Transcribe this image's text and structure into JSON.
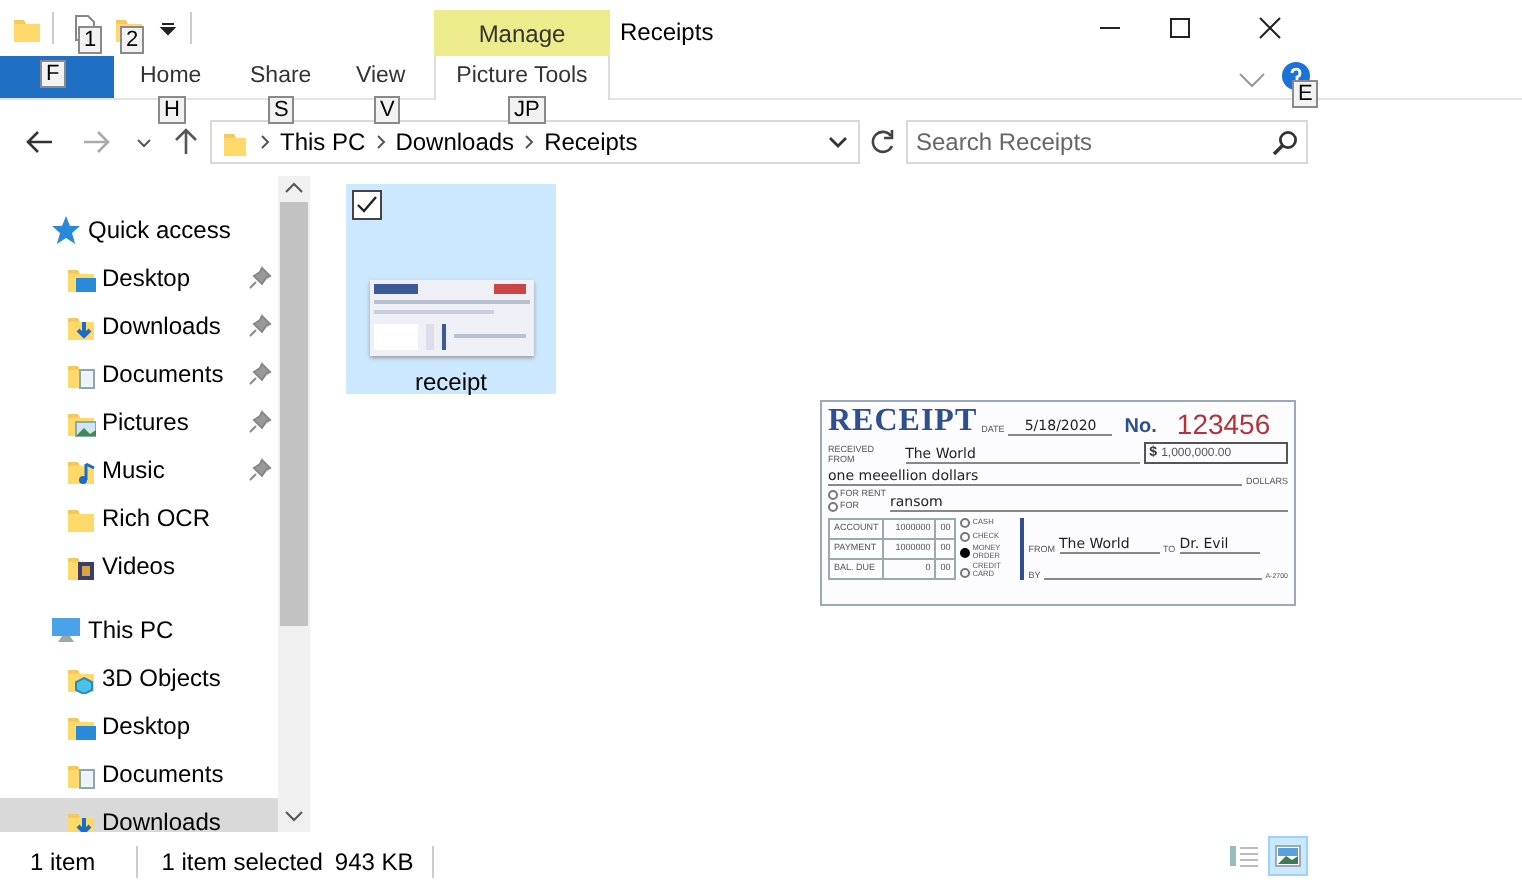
{
  "quick_access_toolbar": {
    "keytips": [
      "1",
      "2"
    ]
  },
  "window": {
    "title": "Receipts"
  },
  "context_tab": {
    "label": "Manage",
    "group": "Picture Tools",
    "keytip": "JP"
  },
  "ribbon_tabs": [
    {
      "kind": "file",
      "keytip": "F"
    },
    {
      "kind": "tab",
      "label": "Home",
      "keytip": "H"
    },
    {
      "kind": "tab",
      "label": "Share",
      "keytip": "S"
    },
    {
      "kind": "tab",
      "label": "View",
      "keytip": "V"
    }
  ],
  "help": {
    "keytip": "E"
  },
  "address": {
    "segments": [
      "This PC",
      "Downloads",
      "Receipts"
    ]
  },
  "search": {
    "placeholder": "Search Receipts"
  },
  "nav": [
    {
      "kind": "quick",
      "label": "Quick access",
      "selected": false,
      "children": [
        {
          "kind": "desktop",
          "label": "Desktop",
          "pinned": true,
          "selected": false
        },
        {
          "kind": "downloads",
          "label": "Downloads",
          "pinned": true,
          "selected": false
        },
        {
          "kind": "documents",
          "label": "Documents",
          "pinned": true,
          "selected": false
        },
        {
          "kind": "pictures",
          "label": "Pictures",
          "pinned": true,
          "selected": false
        },
        {
          "kind": "music",
          "label": "Music",
          "pinned": true,
          "selected": false
        },
        {
          "kind": "folder",
          "label": "Rich OCR",
          "pinned": false,
          "selected": false
        },
        {
          "kind": "videos",
          "label": "Videos",
          "pinned": false,
          "selected": false
        }
      ]
    },
    {
      "kind": "pc",
      "label": "This PC",
      "selected": false,
      "children": [
        {
          "kind": "objects",
          "label": "3D Objects",
          "pinned": false,
          "selected": false
        },
        {
          "kind": "desktop",
          "label": "Desktop",
          "pinned": false,
          "selected": false
        },
        {
          "kind": "documents",
          "label": "Documents",
          "pinned": false,
          "selected": false
        },
        {
          "kind": "downloads",
          "label": "Downloads",
          "pinned": false,
          "selected": true
        }
      ]
    }
  ],
  "files": [
    {
      "name": "receipt",
      "selected": true,
      "checked": true,
      "kind": "picture"
    }
  ],
  "preview": {
    "title": "RECEIPT",
    "date_label": "DATE",
    "date": "5/18/2020",
    "no_label": "No.",
    "number": "123456",
    "received_label": "RECEIVED FROM",
    "received_from": "The World",
    "currency": "$",
    "amount": "1,000,000.00",
    "words": "one meeellion dollars",
    "dollars_label": "DOLLARS",
    "for_options": [
      {
        "label": "FOR RENT",
        "selected": false
      },
      {
        "label": "FOR",
        "selected": false
      }
    ],
    "for": "ransom",
    "ledger": [
      {
        "label": "ACCOUNT",
        "dollars": "1000000",
        "cents": "00"
      },
      {
        "label": "PAYMENT",
        "dollars": "1000000",
        "cents": "00"
      },
      {
        "label": "BAL. DUE",
        "dollars": "0",
        "cents": "00"
      }
    ],
    "methods": [
      {
        "label": "CASH",
        "selected": false
      },
      {
        "label": "CHECK",
        "selected": false
      },
      {
        "label": "MONEY ORDER",
        "selected": true
      },
      {
        "label": "CREDIT CARD",
        "selected": false
      }
    ],
    "from_label": "FROM",
    "from": "The World",
    "to_label": "TO",
    "to": "Dr. Evil",
    "by_label": "BY",
    "form_code": "A-2700"
  },
  "status_bar": {
    "count": "1 item",
    "selection": "1 item selected",
    "size": "943 KB"
  },
  "view_buttons": [
    {
      "kind": "details",
      "selected": false
    },
    {
      "kind": "large-icons",
      "selected": true
    }
  ]
}
